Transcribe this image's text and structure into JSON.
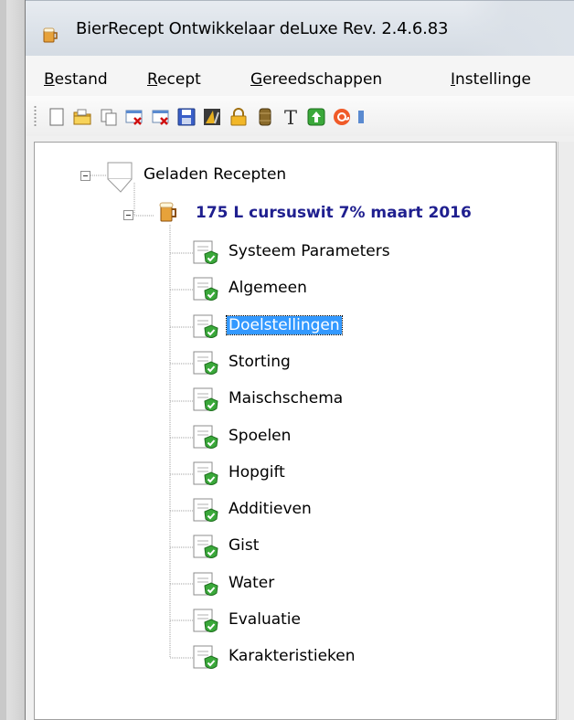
{
  "window": {
    "title": "BierRecept Ontwikkelaar deLuxe Rev. 2.4.6.83"
  },
  "menu": [
    {
      "label": "Bestand",
      "accel": "B",
      "rest": "estand"
    },
    {
      "label": "Recept",
      "accel": "R",
      "rest": "ecept"
    },
    {
      "label": "Gereedschappen",
      "accel": "G",
      "rest": "ereedschappen"
    },
    {
      "label": "Instellinge",
      "accel": "I",
      "rest": "nstellinge"
    }
  ],
  "toolbar": {
    "buttons": [
      "new-icon",
      "open-folder-icon",
      "copy-icon",
      "delete-recipe-icon",
      "delete-icon",
      "save-icon",
      "brewing-icon",
      "lock-icon",
      "barrel-icon",
      "text-icon",
      "export-icon",
      "email-icon"
    ]
  },
  "tree": {
    "root": "Geladen Recepten",
    "recipe": "175 L cursuswit 7%  maart 2016",
    "items": [
      "Systeem Parameters",
      "Algemeen",
      "Doelstellingen",
      "Storting",
      "Maischschema",
      "Spoelen",
      "Hopgift",
      "Additieven",
      "Gist",
      "Water",
      "Evaluatie",
      "Karakteristieken"
    ],
    "selected_index": 2
  },
  "colors": {
    "selection": "#3399ff",
    "recipe_text": "#1f1f8f",
    "check_green": "#3aa83a"
  }
}
